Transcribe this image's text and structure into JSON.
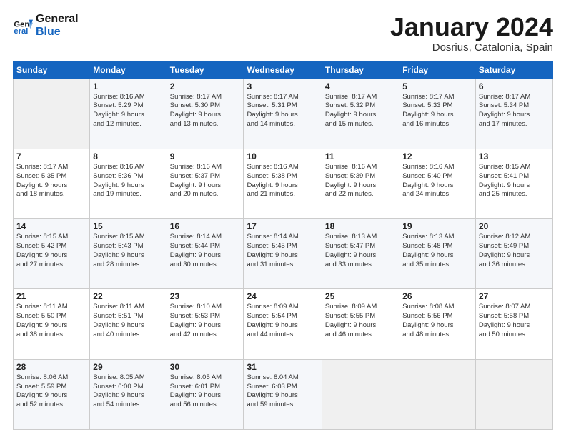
{
  "header": {
    "logo_line1": "General",
    "logo_line2": "Blue",
    "month": "January 2024",
    "location": "Dosrius, Catalonia, Spain"
  },
  "weekdays": [
    "Sunday",
    "Monday",
    "Tuesday",
    "Wednesday",
    "Thursday",
    "Friday",
    "Saturday"
  ],
  "weeks": [
    [
      {
        "num": "",
        "info": ""
      },
      {
        "num": "1",
        "info": "Sunrise: 8:16 AM\nSunset: 5:29 PM\nDaylight: 9 hours\nand 12 minutes."
      },
      {
        "num": "2",
        "info": "Sunrise: 8:17 AM\nSunset: 5:30 PM\nDaylight: 9 hours\nand 13 minutes."
      },
      {
        "num": "3",
        "info": "Sunrise: 8:17 AM\nSunset: 5:31 PM\nDaylight: 9 hours\nand 14 minutes."
      },
      {
        "num": "4",
        "info": "Sunrise: 8:17 AM\nSunset: 5:32 PM\nDaylight: 9 hours\nand 15 minutes."
      },
      {
        "num": "5",
        "info": "Sunrise: 8:17 AM\nSunset: 5:33 PM\nDaylight: 9 hours\nand 16 minutes."
      },
      {
        "num": "6",
        "info": "Sunrise: 8:17 AM\nSunset: 5:34 PM\nDaylight: 9 hours\nand 17 minutes."
      }
    ],
    [
      {
        "num": "7",
        "info": "Sunrise: 8:17 AM\nSunset: 5:35 PM\nDaylight: 9 hours\nand 18 minutes."
      },
      {
        "num": "8",
        "info": "Sunrise: 8:16 AM\nSunset: 5:36 PM\nDaylight: 9 hours\nand 19 minutes."
      },
      {
        "num": "9",
        "info": "Sunrise: 8:16 AM\nSunset: 5:37 PM\nDaylight: 9 hours\nand 20 minutes."
      },
      {
        "num": "10",
        "info": "Sunrise: 8:16 AM\nSunset: 5:38 PM\nDaylight: 9 hours\nand 21 minutes."
      },
      {
        "num": "11",
        "info": "Sunrise: 8:16 AM\nSunset: 5:39 PM\nDaylight: 9 hours\nand 22 minutes."
      },
      {
        "num": "12",
        "info": "Sunrise: 8:16 AM\nSunset: 5:40 PM\nDaylight: 9 hours\nand 24 minutes."
      },
      {
        "num": "13",
        "info": "Sunrise: 8:15 AM\nSunset: 5:41 PM\nDaylight: 9 hours\nand 25 minutes."
      }
    ],
    [
      {
        "num": "14",
        "info": "Sunrise: 8:15 AM\nSunset: 5:42 PM\nDaylight: 9 hours\nand 27 minutes."
      },
      {
        "num": "15",
        "info": "Sunrise: 8:15 AM\nSunset: 5:43 PM\nDaylight: 9 hours\nand 28 minutes."
      },
      {
        "num": "16",
        "info": "Sunrise: 8:14 AM\nSunset: 5:44 PM\nDaylight: 9 hours\nand 30 minutes."
      },
      {
        "num": "17",
        "info": "Sunrise: 8:14 AM\nSunset: 5:45 PM\nDaylight: 9 hours\nand 31 minutes."
      },
      {
        "num": "18",
        "info": "Sunrise: 8:13 AM\nSunset: 5:47 PM\nDaylight: 9 hours\nand 33 minutes."
      },
      {
        "num": "19",
        "info": "Sunrise: 8:13 AM\nSunset: 5:48 PM\nDaylight: 9 hours\nand 35 minutes."
      },
      {
        "num": "20",
        "info": "Sunrise: 8:12 AM\nSunset: 5:49 PM\nDaylight: 9 hours\nand 36 minutes."
      }
    ],
    [
      {
        "num": "21",
        "info": "Sunrise: 8:11 AM\nSunset: 5:50 PM\nDaylight: 9 hours\nand 38 minutes."
      },
      {
        "num": "22",
        "info": "Sunrise: 8:11 AM\nSunset: 5:51 PM\nDaylight: 9 hours\nand 40 minutes."
      },
      {
        "num": "23",
        "info": "Sunrise: 8:10 AM\nSunset: 5:53 PM\nDaylight: 9 hours\nand 42 minutes."
      },
      {
        "num": "24",
        "info": "Sunrise: 8:09 AM\nSunset: 5:54 PM\nDaylight: 9 hours\nand 44 minutes."
      },
      {
        "num": "25",
        "info": "Sunrise: 8:09 AM\nSunset: 5:55 PM\nDaylight: 9 hours\nand 46 minutes."
      },
      {
        "num": "26",
        "info": "Sunrise: 8:08 AM\nSunset: 5:56 PM\nDaylight: 9 hours\nand 48 minutes."
      },
      {
        "num": "27",
        "info": "Sunrise: 8:07 AM\nSunset: 5:58 PM\nDaylight: 9 hours\nand 50 minutes."
      }
    ],
    [
      {
        "num": "28",
        "info": "Sunrise: 8:06 AM\nSunset: 5:59 PM\nDaylight: 9 hours\nand 52 minutes."
      },
      {
        "num": "29",
        "info": "Sunrise: 8:05 AM\nSunset: 6:00 PM\nDaylight: 9 hours\nand 54 minutes."
      },
      {
        "num": "30",
        "info": "Sunrise: 8:05 AM\nSunset: 6:01 PM\nDaylight: 9 hours\nand 56 minutes."
      },
      {
        "num": "31",
        "info": "Sunrise: 8:04 AM\nSunset: 6:03 PM\nDaylight: 9 hours\nand 59 minutes."
      },
      {
        "num": "",
        "info": ""
      },
      {
        "num": "",
        "info": ""
      },
      {
        "num": "",
        "info": ""
      }
    ]
  ]
}
